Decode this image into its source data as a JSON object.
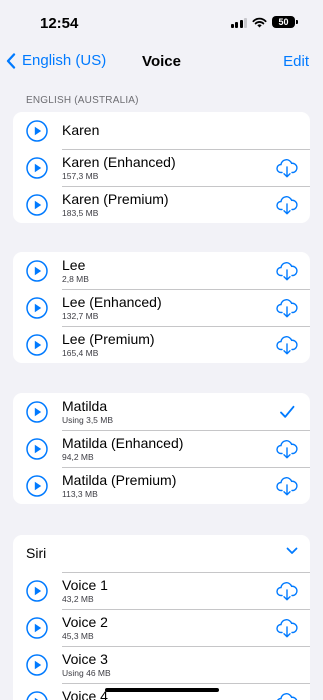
{
  "status": {
    "time": "12:54",
    "battery": "50"
  },
  "nav": {
    "back_label": "English (US)",
    "title": "Voice",
    "edit_label": "Edit"
  },
  "section": {
    "header": "ENGLISH (AUSTRALIA)"
  },
  "groups": [
    {
      "items": [
        {
          "name": "Karen",
          "size": "",
          "accessory": "none"
        },
        {
          "name": "Karen (Enhanced)",
          "size": "157,3 MB",
          "accessory": "cloud-download-icon"
        },
        {
          "name": "Karen (Premium)",
          "size": "183,5 MB",
          "accessory": "cloud-download-icon"
        }
      ]
    },
    {
      "items": [
        {
          "name": "Lee",
          "size": "2,8 MB",
          "accessory": "cloud-download-icon"
        },
        {
          "name": "Lee (Enhanced)",
          "size": "132,7 MB",
          "accessory": "cloud-download-icon"
        },
        {
          "name": "Lee (Premium)",
          "size": "165,4 MB",
          "accessory": "cloud-download-icon"
        }
      ]
    },
    {
      "items": [
        {
          "name": "Matilda",
          "size": "Using 3,5 MB",
          "accessory": "checkmark-icon"
        },
        {
          "name": "Matilda (Enhanced)",
          "size": "94,2 MB",
          "accessory": "cloud-download-icon"
        },
        {
          "name": "Matilda (Premium)",
          "size": "113,3 MB",
          "accessory": "cloud-download-icon"
        }
      ]
    },
    {
      "header": "Siri",
      "items": [
        {
          "name": "Voice 1",
          "size": "43,2 MB",
          "accessory": "cloud-download-icon"
        },
        {
          "name": "Voice 2",
          "size": "45,3 MB",
          "accessory": "cloud-download-icon"
        },
        {
          "name": "Voice 3",
          "size": "Using 46 MB",
          "accessory": "none"
        },
        {
          "name": "Voice 4",
          "size": "",
          "accessory": "cloud-download-icon"
        }
      ]
    }
  ],
  "colors": {
    "accent": "#007aff",
    "background": "#f2f2f7"
  }
}
